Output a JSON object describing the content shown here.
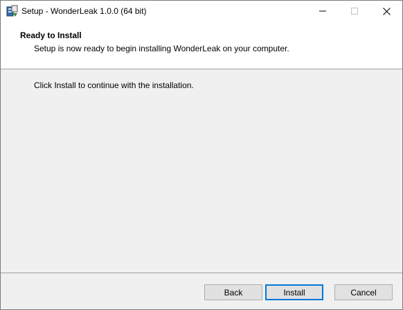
{
  "window": {
    "title": "Setup - WonderLeak 1.0.0 (64 bit)"
  },
  "header": {
    "title": "Ready to Install",
    "subtitle": "Setup is now ready to begin installing WonderLeak on your computer."
  },
  "main": {
    "message": "Click Install to continue with the installation."
  },
  "buttons": {
    "back": "Back",
    "install": "Install",
    "cancel": "Cancel"
  },
  "icons": {
    "app": "setup-app-icon",
    "minimize": "minimize-icon",
    "maximize": "maximize-icon",
    "close": "close-icon"
  },
  "colors": {
    "accent": "#0078d7",
    "panel": "#f0f0f0"
  }
}
